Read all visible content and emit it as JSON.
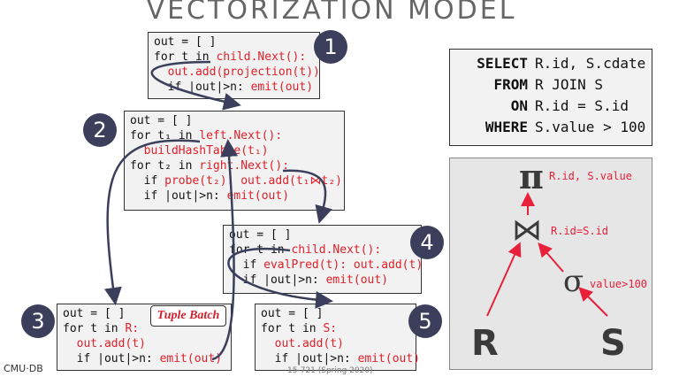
{
  "slide": {
    "title": "VECTORIZATION MODEL",
    "footer_left": "CMU·DB",
    "footer_mid": "15-721 (Spring 2020)"
  },
  "operators": [
    {
      "number": "1",
      "lines": [
        {
          "pre": "out = [ ]",
          "hl": "",
          "post": ""
        },
        {
          "pre": "for t in ",
          "hl": "child.Next():",
          "post": ""
        },
        {
          "pre": "  ",
          "hl": "out.add(projection(t))",
          "post": ""
        },
        {
          "pre": "  if |out|>n: ",
          "hl": "emit(out)",
          "post": ""
        }
      ]
    },
    {
      "number": "2",
      "lines": [
        {
          "pre": "out = [ ]",
          "hl": "",
          "post": ""
        },
        {
          "pre": "for t₁ in ",
          "hl": "left.Next():",
          "post": ""
        },
        {
          "pre": "  ",
          "hl": "buildHashTable(t₁)",
          "post": ""
        },
        {
          "pre": "for t₂ in ",
          "hl": "right.Next():",
          "post": ""
        },
        {
          "pre": "  if ",
          "hl": "probe(t₂): out.add(t₁⋈t₂)",
          "post": ""
        },
        {
          "pre": "  if |out|>n: ",
          "hl": "emit(out)",
          "post": ""
        }
      ]
    },
    {
      "number": "4",
      "lines": [
        {
          "pre": "out = [ ]",
          "hl": "",
          "post": ""
        },
        {
          "pre": "for t in ",
          "hl": "child.Next():",
          "post": ""
        },
        {
          "pre": "  if ",
          "hl": "evalPred(t): out.add(t)",
          "post": ""
        },
        {
          "pre": "  if |out|>n: ",
          "hl": "emit(out)",
          "post": ""
        }
      ]
    },
    {
      "number": "3",
      "lines": [
        {
          "pre": "out = [ ]",
          "hl": "",
          "post": ""
        },
        {
          "pre": "for t in ",
          "hl": "R:",
          "post": ""
        },
        {
          "pre": "  ",
          "hl": "out.add(t)",
          "post": ""
        },
        {
          "pre": "  if |out|>n: ",
          "hl": "emit(out)",
          "post": ""
        }
      ]
    },
    {
      "number": "5",
      "lines": [
        {
          "pre": "out = [ ]",
          "hl": "",
          "post": ""
        },
        {
          "pre": "for t in ",
          "hl": "S:",
          "post": ""
        },
        {
          "pre": "  ",
          "hl": "out.add(t)",
          "post": ""
        },
        {
          "pre": "  if |out|>n: ",
          "hl": "emit(out)",
          "post": ""
        }
      ]
    }
  ],
  "badge": "Tuple Batch",
  "sql": [
    {
      "keyword": "SELECT",
      "text": "R.id, S.cdate"
    },
    {
      "keyword": "FROM",
      "text": "R JOIN S"
    },
    {
      "keyword": "ON",
      "text": "R.id = S.id"
    },
    {
      "keyword": "WHERE",
      "text": "S.value > 100"
    }
  ],
  "plan": {
    "projection_symbol": "π",
    "projection_label": "R.id, S.value",
    "join_symbol": "⋈",
    "join_label": "R.id=S.id",
    "selection_symbol": "σ",
    "selection_label": "value>100",
    "left_table": "R",
    "right_table": "S"
  },
  "colors": {
    "highlight": "#e0202a",
    "circle": "#3b3f5c",
    "arrow": "#3b3f5c"
  }
}
